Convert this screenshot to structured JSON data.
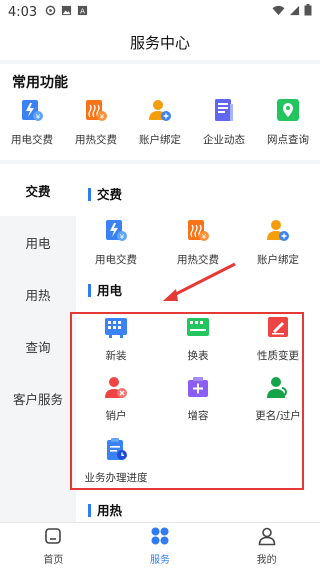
{
  "status_bar": {
    "time": "4:03"
  },
  "header": {
    "title": "服务中心"
  },
  "common_functions": {
    "heading": "常用功能",
    "items": [
      {
        "label": "用电交费",
        "icon": "electric-pay-icon"
      },
      {
        "label": "用热交费",
        "icon": "heat-pay-icon"
      },
      {
        "label": "账户绑定",
        "icon": "account-bind-icon"
      },
      {
        "label": "企业动态",
        "icon": "news-icon"
      },
      {
        "label": "网点查询",
        "icon": "map-pin-icon"
      }
    ]
  },
  "sidebar": {
    "items": [
      {
        "label": "交费",
        "active": true
      },
      {
        "label": "用电"
      },
      {
        "label": "用热"
      },
      {
        "label": "查询"
      },
      {
        "label": "客户服务"
      }
    ]
  },
  "sections": {
    "pay": {
      "title": "交费",
      "items": [
        {
          "label": "用电交费"
        },
        {
          "label": "用热交费"
        },
        {
          "label": "账户绑定"
        }
      ]
    },
    "electric": {
      "title": "用电",
      "items": [
        {
          "label": "新装"
        },
        {
          "label": "换表"
        },
        {
          "label": "性质变更"
        },
        {
          "label": "销户"
        },
        {
          "label": "增容"
        },
        {
          "label": "更名/过户"
        },
        {
          "label": "业务办理进度"
        }
      ]
    },
    "heat": {
      "title": "用热"
    }
  },
  "tabbar": {
    "items": [
      {
        "label": "首页"
      },
      {
        "label": "服务",
        "active": true
      },
      {
        "label": "我的"
      }
    ]
  },
  "colors": {
    "accent": "#2f7cf6",
    "highlight": "#e53935"
  }
}
